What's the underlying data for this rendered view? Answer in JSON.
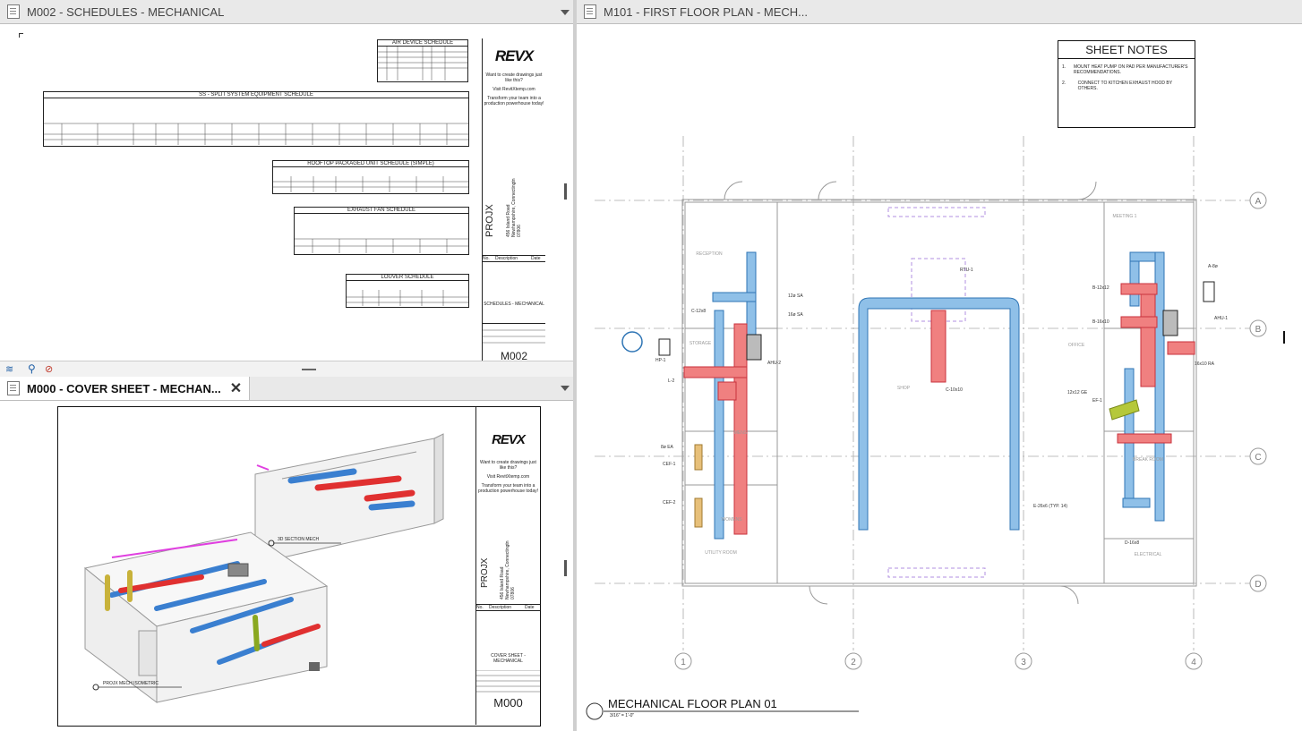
{
  "tabs": {
    "m002": "M002 - SCHEDULES - MECHANICAL",
    "m000": "M000 - COVER SHEET - MECHAN...",
    "m101": "M101 - FIRST FLOOR PLAN - MECH..."
  },
  "m002_sheet": {
    "air_device_schedule": "AIR DEVICE SCHEDULE",
    "split_system_schedule": "SS - SPLIT SYSTEM EQUIPMENT SCHEDULE",
    "packaged_unit_schedule": "ROOFTOP PACKAGED UNIT SCHEDULE (SIMPLE)",
    "exhaust_fan_schedule": "EXHAUST FAN SCHEDULE",
    "louver_schedule": "LOUVER SCHEDULE",
    "brand": "REVX",
    "promo_1": "Want to create drawings just like this?",
    "promo_2": "Visit RevitXtemp.com",
    "promo_3": "Transform your team into a production powerhouse today!",
    "project": "PROJX",
    "address": "456 Island Road\nNewhampshire, Connectingtn\n07806",
    "sheet_name": "SCHEDULES - MECHANICAL",
    "sheet_number": "M002",
    "rev_cols": [
      "No.",
      "Description",
      "Date"
    ]
  },
  "m000_sheet": {
    "brand": "REVX",
    "section_label": "3D SECTION MECH",
    "iso_label": "PROJX MECH ISOMETRIC",
    "project": "PROJX",
    "sheet_name": "COVER SHEET - MECHANICAL",
    "sheet_number": "M000",
    "rev_cols": [
      "No.",
      "Description",
      "Date"
    ]
  },
  "m101_sheet": {
    "sheet_notes_title": "SHEET NOTES",
    "notes": [
      {
        "num": "1.",
        "text": "MOUNT HEAT PUMP ON PAD PER MANUFACTURER'S RECOMMENDATIONS."
      },
      {
        "num": "2.",
        "text": "CONNECT TO KITCHEN EXHAUST HOOD BY OTHERS."
      }
    ],
    "grid_rows": [
      "A",
      "B",
      "C",
      "D"
    ],
    "grid_cols": [
      "1",
      "2",
      "3",
      "4"
    ],
    "plan_title": "MECHANICAL FLOOR PLAN 01",
    "plan_scale": "3/16\" = 1'-0\"",
    "rooms": {
      "reception": "RECEPTION",
      "storage": "STORAGE",
      "mens": "MENS",
      "womens": "WOMENS",
      "utility": "UTILITY ROOM",
      "shop": "SHOP",
      "meeting": "MEETING 1",
      "office": "OFFICE",
      "break": "BREAK ROOM",
      "electrical": "ELECTRICAL"
    },
    "tags": {
      "ahu2": "AHU-2",
      "ahu1": "AHU-1",
      "hp1": "HP-1",
      "l2": "L-2",
      "cef1_left": "CEF-1",
      "cef2": "CEF-2",
      "ef1": "EF-1",
      "rtu1": "RTU-1",
      "c10x10": "C-10x10",
      "d12x12": "12x12 GE",
      "e26x6": "E-26x6 (TYP. 14)",
      "sa12": "12ø SA",
      "sa16": "16ø SA",
      "ea8": "8ø EA",
      "ra16x10": "16x10 RA",
      "b12x12": "B-12x12",
      "b16x10": "B-16x10",
      "a8": "A-8ø",
      "c12x8": "C-12x8",
      "d16x8": "D-16x8"
    }
  },
  "colors": {
    "supply": "#8fc0e8",
    "supply_stroke": "#2f75b5",
    "return": "#f08080",
    "return_stroke": "#c8323c",
    "exhaust": "#e7c07a",
    "exhaust_green": "#b5c83a"
  }
}
